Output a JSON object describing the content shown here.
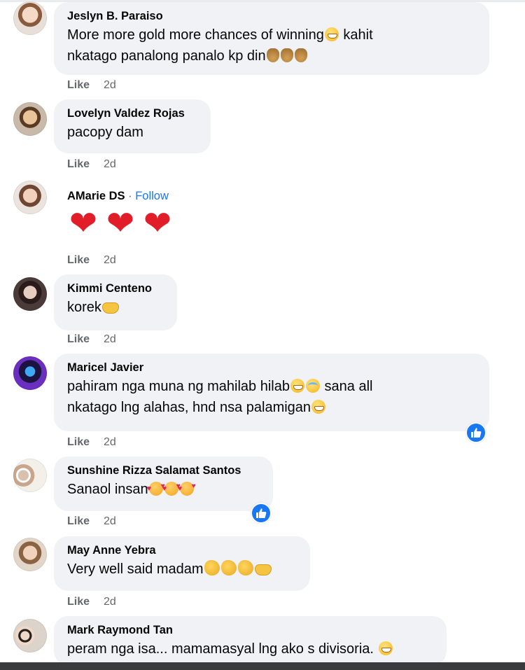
{
  "like_label": "Like",
  "colors": {
    "bubble": "#f0f2f5",
    "author": "#050505",
    "meta": "#65676b",
    "follow": "#1877f2",
    "reaction": "#1877f2",
    "heart": "#e11d2a"
  },
  "comments": [
    {
      "author": "Jeslyn B. Paraiso",
      "lines": [
        "More more gold more chances of winning",
        "nkatago panalong panalo kp din"
      ],
      "line1_tail": "kahit",
      "time": "2d",
      "avatar_icon": "avatar-photo",
      "emoji": [
        "grinning-face-emoji",
        "money-bag-emoji"
      ]
    },
    {
      "author": "Lovelyn Valdez Rojas",
      "lines": [
        "pacopy dam"
      ],
      "time": "2d",
      "avatar_icon": "avatar-photo"
    },
    {
      "author": "AMarie DS",
      "follow_sep": "·",
      "follow": "Follow",
      "lines": [
        "❤",
        "❤",
        "❤"
      ],
      "time": "2d",
      "avatar_icon": "avatar-photo"
    },
    {
      "author": "Kimmi Centeno",
      "lines": [
        "korek"
      ],
      "time": "2d",
      "avatar_icon": "avatar-photo",
      "emoji": [
        "heart-hands-emoji"
      ]
    },
    {
      "author": "Maricel Javier",
      "lines": [
        "pahiram nga muna ng mahilab hilab",
        "nkatago lng alahas, hnd nsa palamigan"
      ],
      "line1_tail": "sana all",
      "time": "2d",
      "avatar_icon": "avatar-photo",
      "reaction": "like-reaction-icon"
    },
    {
      "author": "Sunshine Rizza Salamat Santos",
      "lines": [
        "Sanaol insan"
      ],
      "time": "2d",
      "avatar_icon": "avatar-photo",
      "reaction": "like-reaction-icon"
    },
    {
      "author": "May Anne Yebra",
      "lines": [
        "Very well said madam"
      ],
      "time": "2d",
      "avatar_icon": "avatar-photo"
    },
    {
      "author": "Mark Raymond Tan",
      "lines": [
        "peram nga isa... mamamasyal lng ako s divisoria."
      ],
      "time": "",
      "avatar_icon": "avatar-photo"
    }
  ]
}
